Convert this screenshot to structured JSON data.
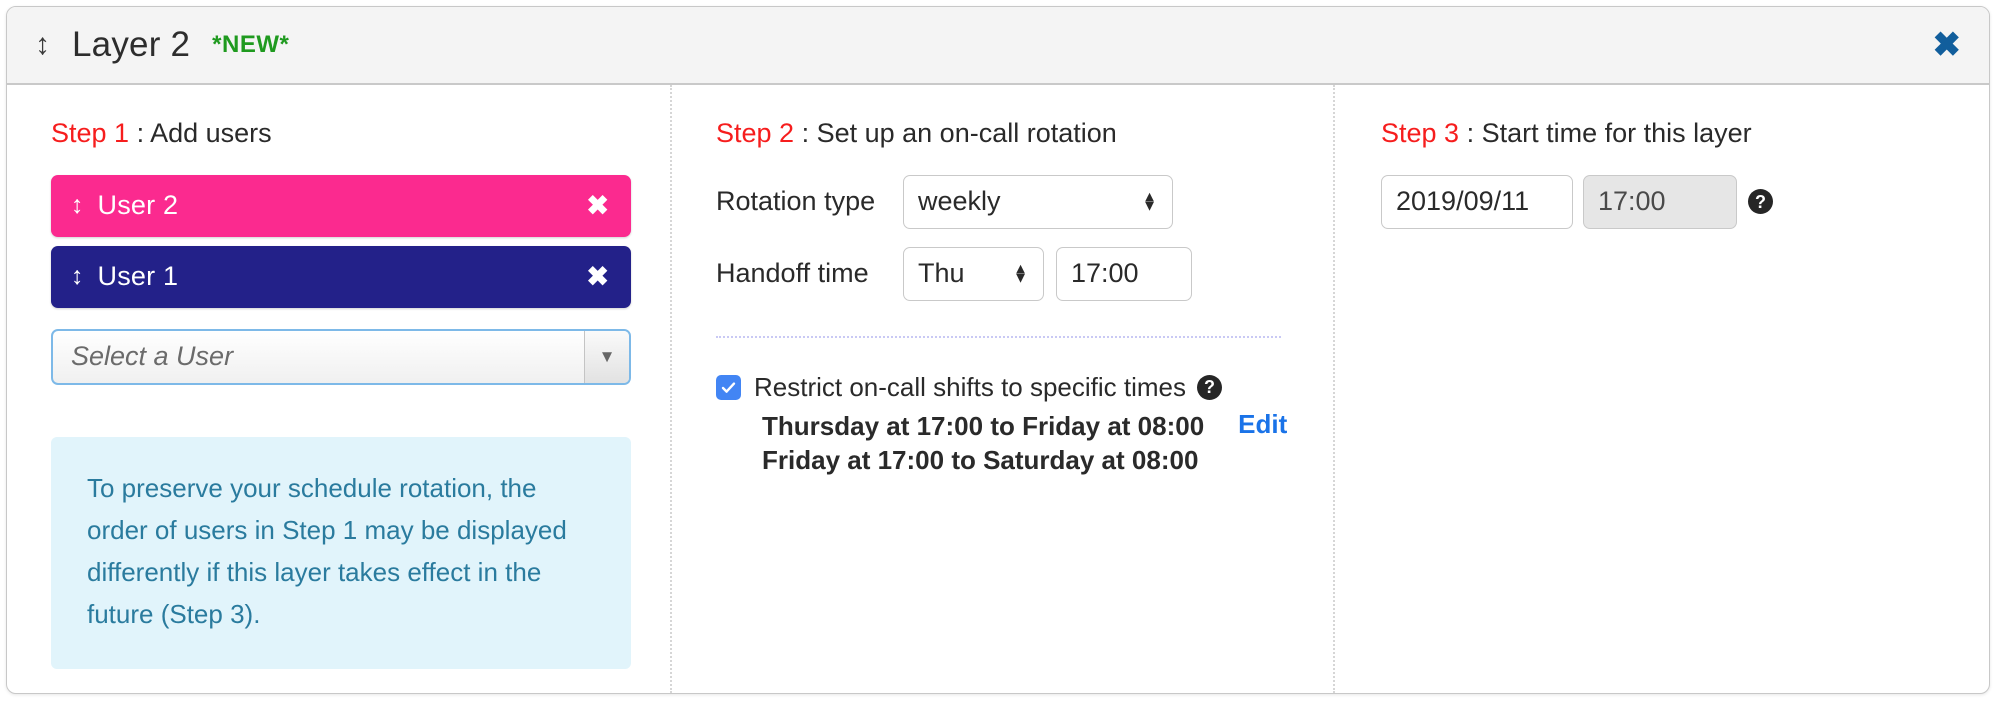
{
  "header": {
    "drag_handle_icon": "vertical-resize-arrows",
    "title": "Layer 2",
    "badge": "*NEW*",
    "close_icon": "✖"
  },
  "step1": {
    "step_num": "Step 1",
    "separator": " : ",
    "title": "Add users",
    "users": [
      {
        "name": "User 2",
        "color": "#fb2a8f",
        "handle_icon": "↕",
        "remove_icon": "✖"
      },
      {
        "name": "User 1",
        "color": "#232189",
        "handle_icon": "↕",
        "remove_icon": "✖"
      }
    ],
    "user_select": {
      "placeholder": "Select a User",
      "arrow_icon": "▼"
    },
    "info_text": "To preserve your schedule rotation, the order of users in Step 1 may be displayed differently if this layer takes effect in the future (Step 3)."
  },
  "step2": {
    "step_num": "Step 2",
    "separator": " : ",
    "title": "Set up an on-call rotation",
    "rotation_type_label": "Rotation type",
    "rotation_type_value": "weekly",
    "handoff_time_label": "Handoff time",
    "handoff_day_value": "Thu",
    "handoff_time_value": "17:00",
    "restrict_label": "Restrict on-call shifts to specific times",
    "restrict_checked": true,
    "restrict_help_icon": "?",
    "shifts": [
      "Thursday at 17:00 to Friday at 08:00",
      "Friday at 17:00 to Saturday at 08:00"
    ],
    "edit_label": "Edit"
  },
  "step3": {
    "step_num": "Step 3",
    "separator": " : ",
    "title": "Start time for this layer",
    "date_value": "2019/09/11",
    "time_value": "17:00",
    "help_icon": "?"
  }
}
